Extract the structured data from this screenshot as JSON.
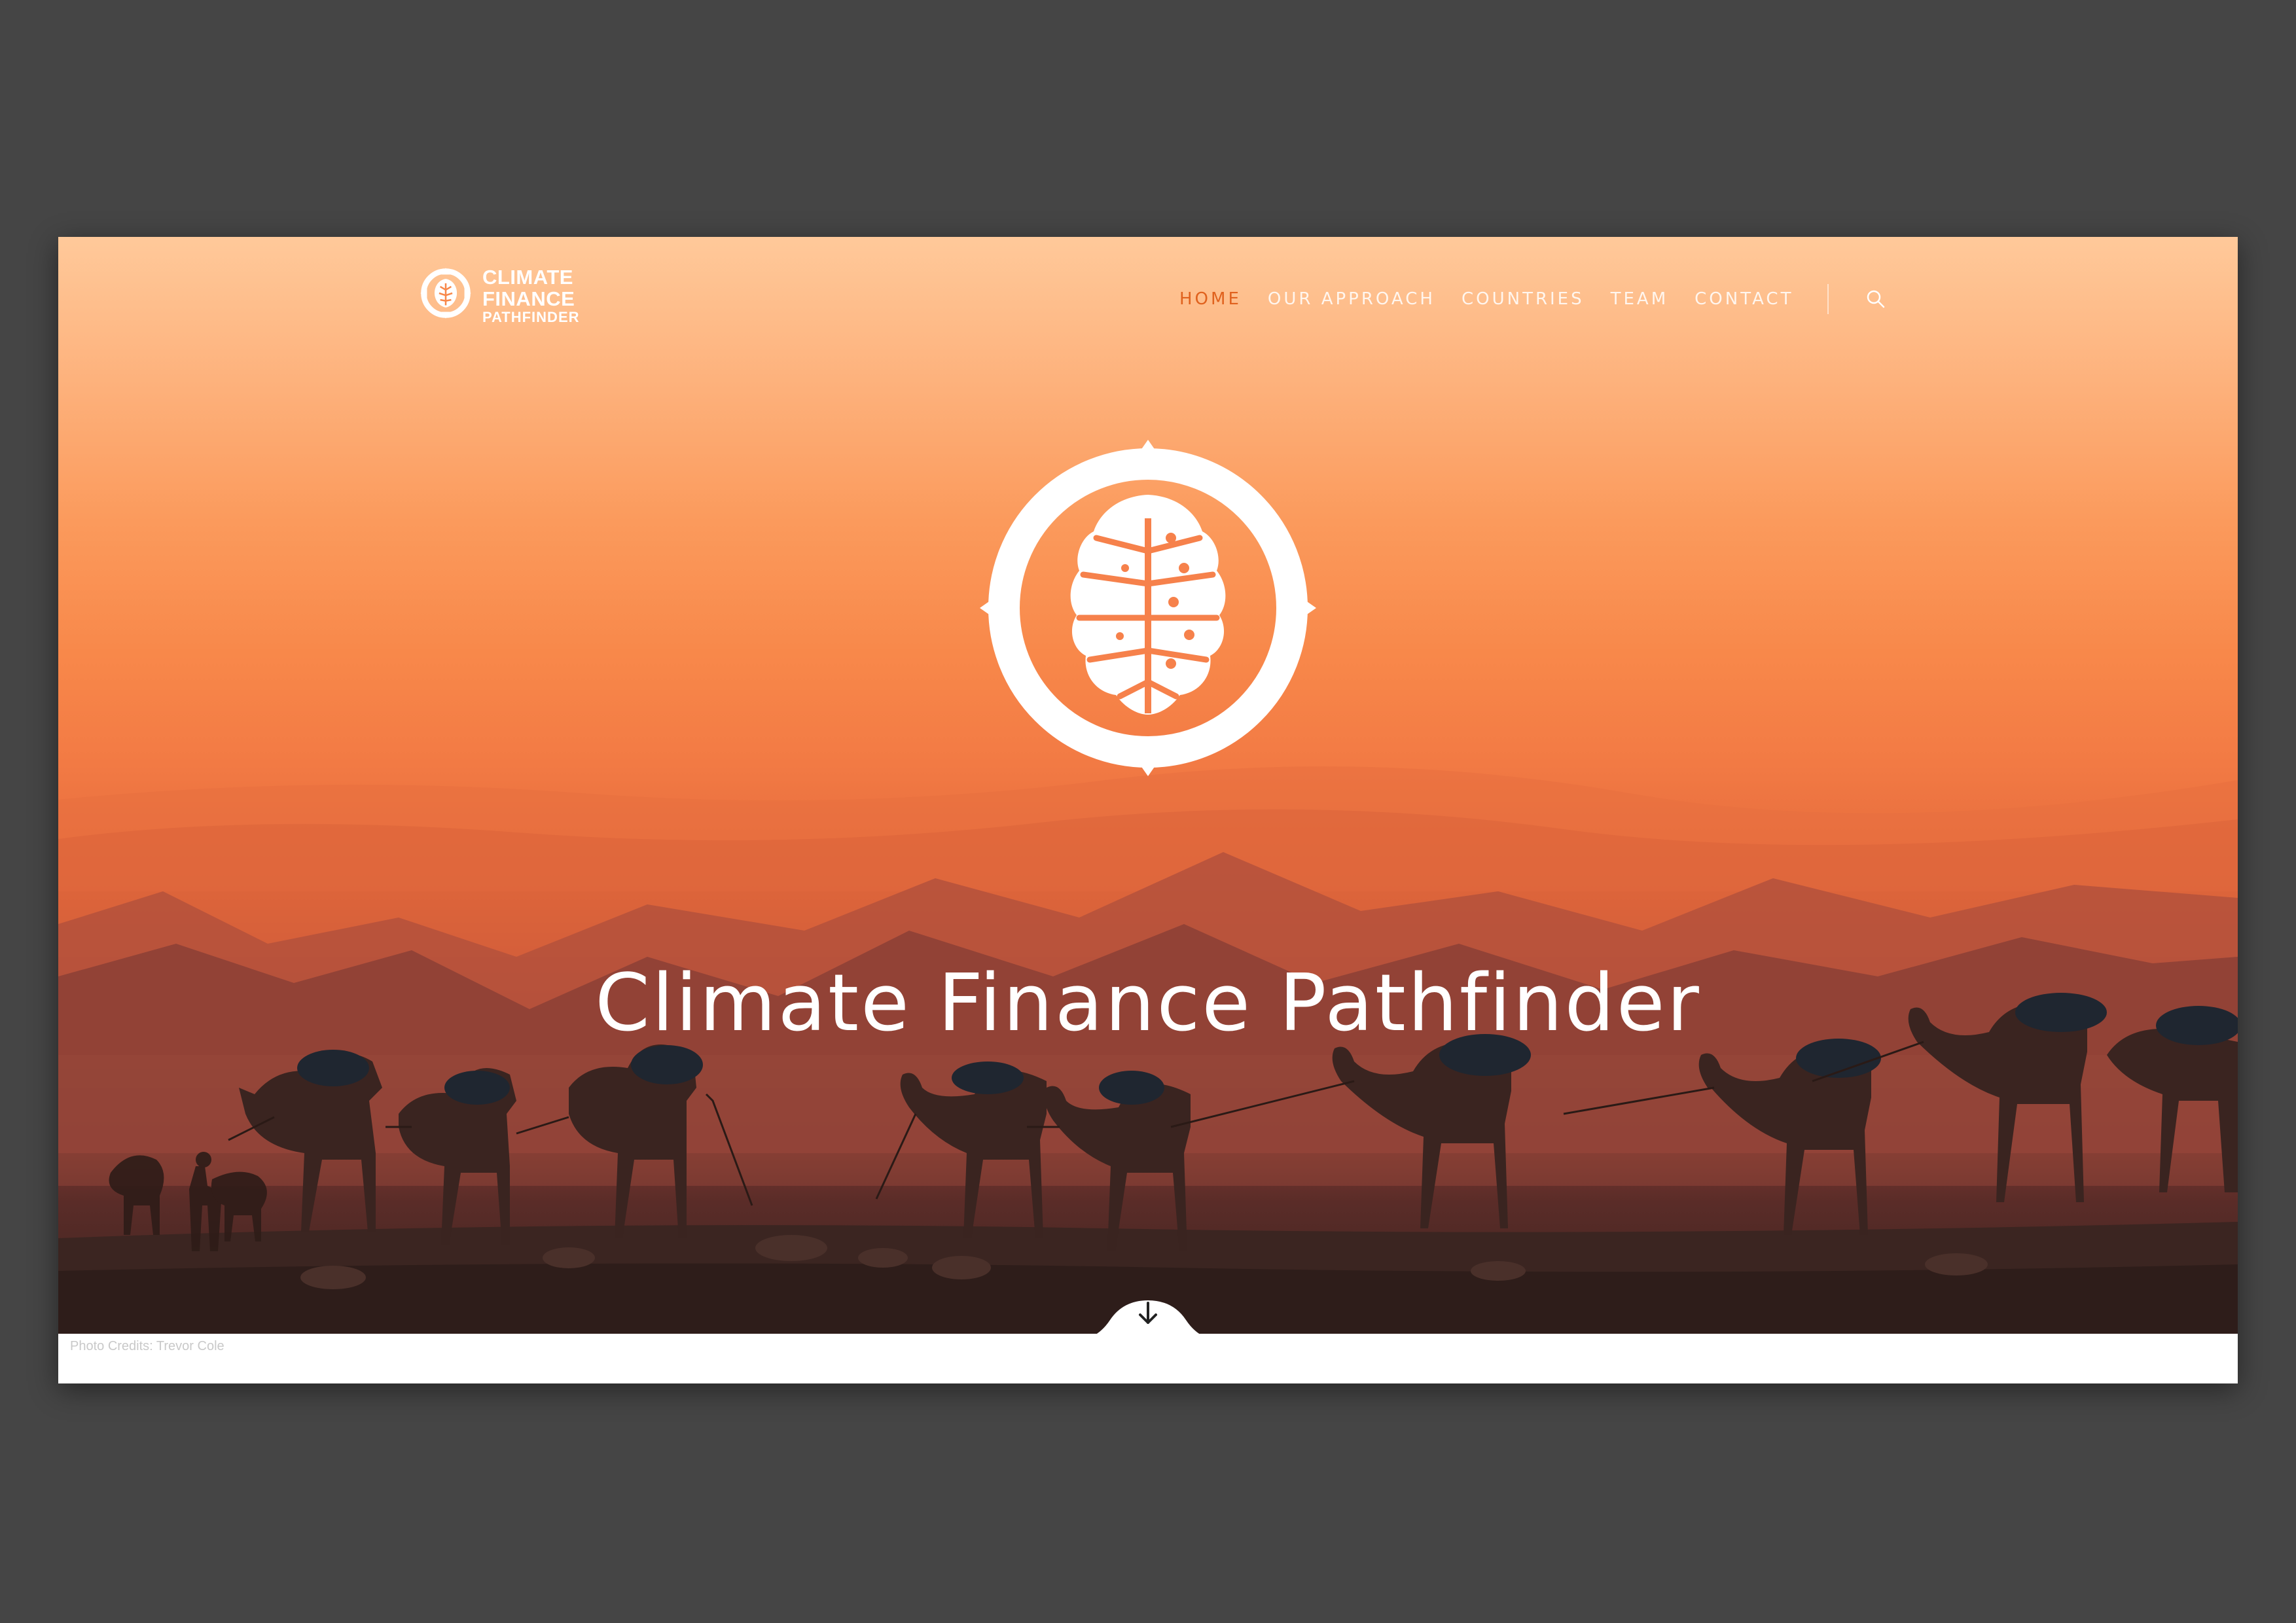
{
  "brand": {
    "logo_line1": "CLIMATE",
    "logo_line2": "FINANCE",
    "logo_line3": "PATHFINDER"
  },
  "nav": {
    "items": [
      {
        "label": "HOME",
        "active": true
      },
      {
        "label": "OUR APPROACH",
        "active": false
      },
      {
        "label": "COUNTRIES",
        "active": false
      },
      {
        "label": "TEAM",
        "active": false
      },
      {
        "label": "CONTACT",
        "active": false
      }
    ],
    "search_icon": "search-icon",
    "active_color": "#e0621e"
  },
  "hero": {
    "emblem_icon": "leaf-compass-emblem",
    "title": "Climate Finance Pathfinder",
    "scroll_icon": "arrow-down-icon"
  },
  "footer": {
    "credits": "Photo Credits: Trevor Cole"
  },
  "colors": {
    "backdrop": "#454545",
    "sky_top": "#ffc99a",
    "sky_mid": "#f8884a",
    "ground": "#3a2420"
  }
}
